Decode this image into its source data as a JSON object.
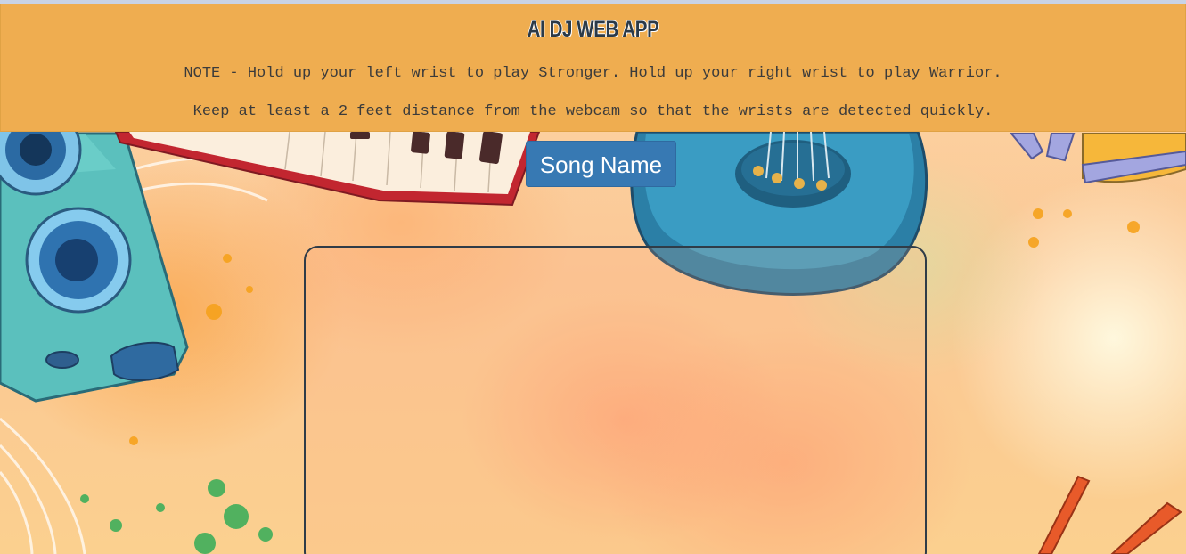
{
  "header": {
    "title": "AI DJ WEB APP",
    "note_line1": "NOTE - Hold up your left wrist to play Stronger. Hold up your right wrist to play Warrior.",
    "note_line2": "Keep at least a 2 feet distance from the webcam so that the wrists are detected quickly."
  },
  "song_button": {
    "label": "Song Name"
  },
  "colors": {
    "header_bg": "#efad50",
    "button_bg": "#3779b3",
    "title_text": "#2b3a48"
  },
  "icons": [
    "speaker-illustration",
    "keyboard-illustration",
    "guitar-illustration",
    "drumsticks-illustration"
  ]
}
